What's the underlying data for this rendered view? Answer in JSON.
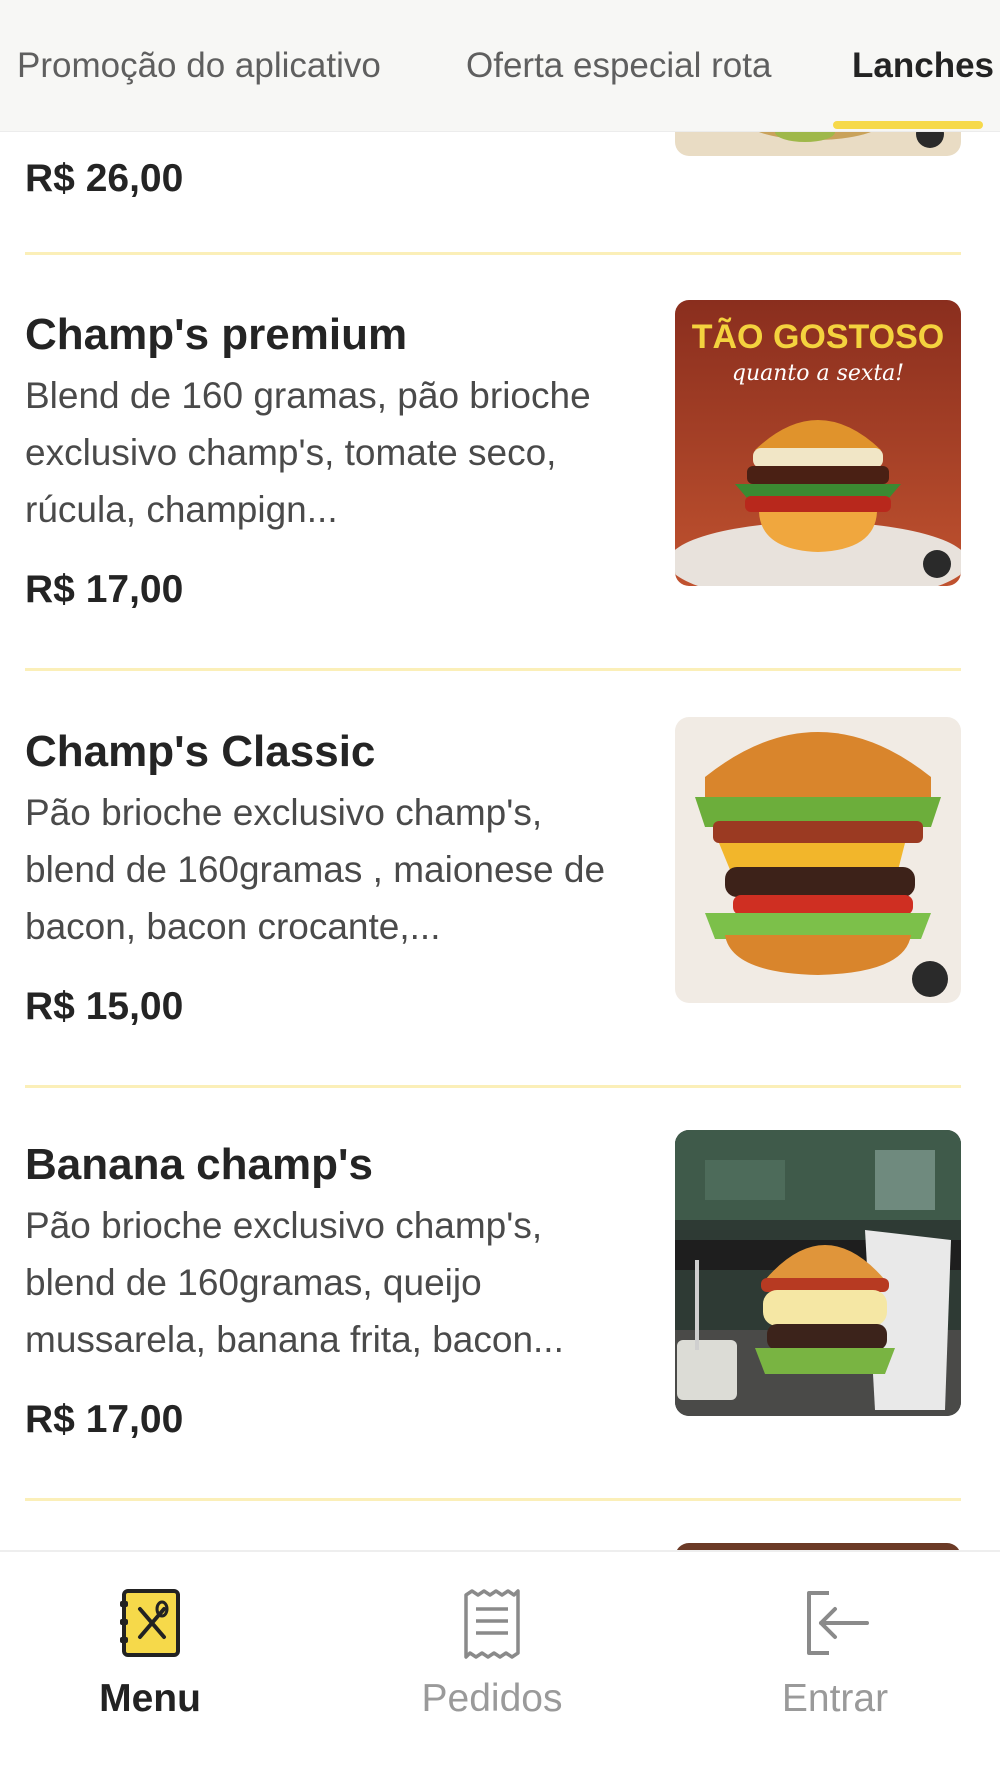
{
  "tabs": {
    "items": [
      {
        "label": "Promoção do aplicativo"
      },
      {
        "label": "Oferta especial rota"
      },
      {
        "label": "Lanches"
      }
    ],
    "active": "Lanches"
  },
  "menu": {
    "partial_item": {
      "price": "R$ 26,00"
    },
    "items": [
      {
        "name": "Champ's premium",
        "description": "Blend de 160 gramas, pão brioche exclusivo champ's, tomate seco, rúcula, champign...",
        "price": "R$ 17,00",
        "image_text_main": "TÃO GOSTOSO",
        "image_text_script": "quanto a sexta!"
      },
      {
        "name": "Champ's Classic",
        "description": "Pão brioche exclusivo champ's, blend de 160gramas , maionese de bacon, bacon crocante,...",
        "price": "R$ 15,00"
      },
      {
        "name": "Banana champ's",
        "description": "Pão brioche exclusivo champ's, blend de 160gramas, queijo mussarela, banana frita, bacon...",
        "price": "R$ 17,00"
      }
    ]
  },
  "bottom_nav": {
    "items": [
      {
        "label": "Menu",
        "icon": "menu-book-icon",
        "active": true
      },
      {
        "label": "Pedidos",
        "icon": "receipt-icon",
        "active": false
      },
      {
        "label": "Entrar",
        "icon": "login-icon",
        "active": false
      }
    ]
  },
  "colors": {
    "accent": "#f6d94a",
    "divider": "#fbefb8",
    "tab_bar_bg": "#f7f7f5",
    "text_dark": "#242424",
    "text_muted": "#9a9a9a"
  }
}
